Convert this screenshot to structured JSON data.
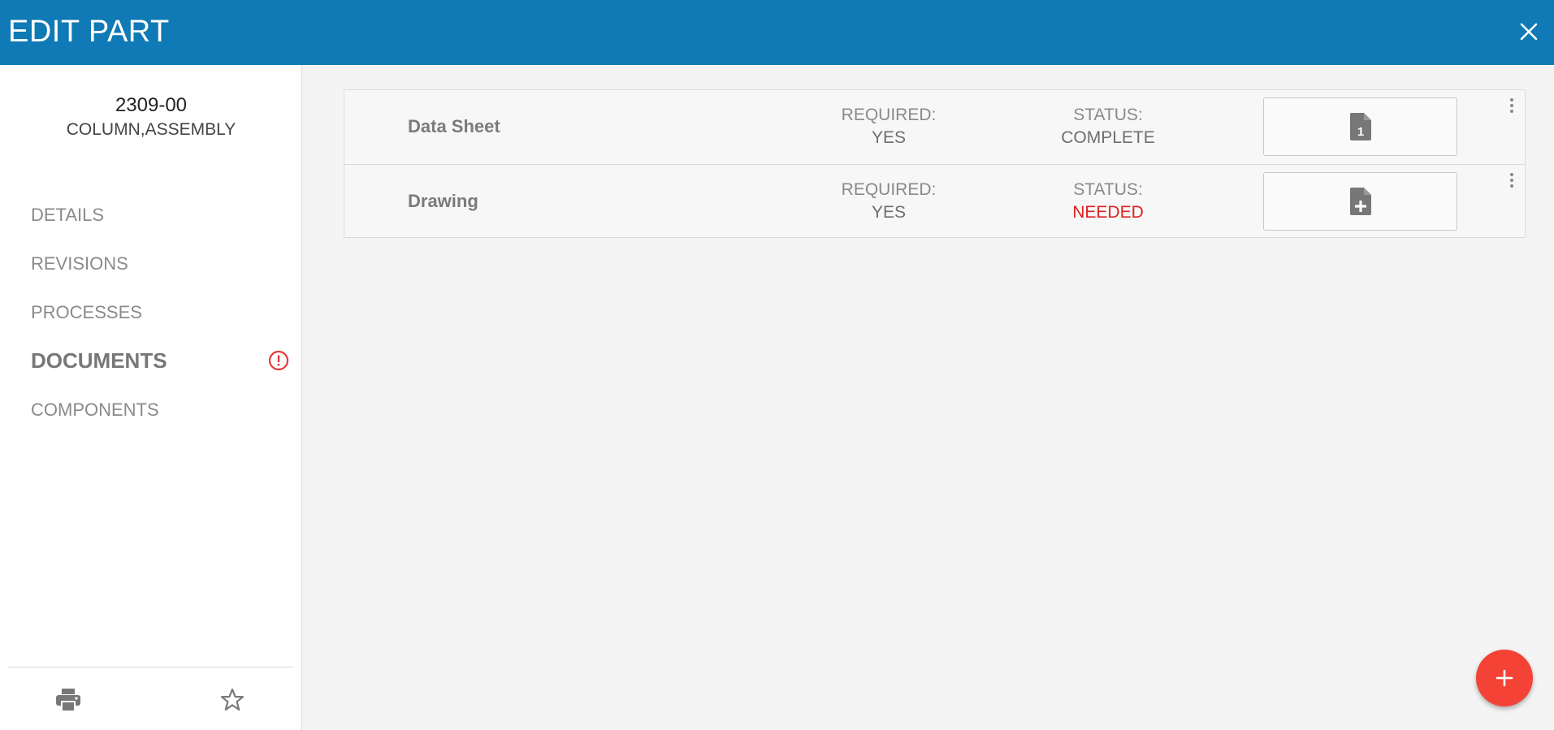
{
  "header": {
    "title": "EDIT PART",
    "close_icon": "close-icon"
  },
  "part": {
    "number": "2309-00",
    "description": "COLUMN,ASSEMBLY"
  },
  "nav": {
    "items": [
      {
        "label": "DETAILS",
        "active": false
      },
      {
        "label": "REVISIONS",
        "active": false
      },
      {
        "label": "PROCESSES",
        "active": false
      },
      {
        "label": "DOCUMENTS",
        "active": true,
        "alert_icon": "alert-circle-icon"
      },
      {
        "label": "COMPONENTS",
        "active": false
      }
    ]
  },
  "sidebar_footer": {
    "print_icon": "print-icon",
    "favorite_icon": "star-outline-icon"
  },
  "documents": [
    {
      "name": "Data Sheet",
      "required_label": "REQUIRED:",
      "required_value": "YES",
      "status_label": "STATUS:",
      "status_value": "COMPLETE",
      "file_icon": "file-count-icon",
      "file_count": "1",
      "menu_icon": "more-vertical-icon"
    },
    {
      "name": "Drawing",
      "required_label": "REQUIRED:",
      "required_value": "YES",
      "status_label": "STATUS:",
      "status_value": "NEEDED",
      "file_icon": "file-add-icon",
      "menu_icon": "more-vertical-icon"
    }
  ],
  "fab": {
    "icon": "plus-icon"
  },
  "colors": {
    "header": "#0f7ab5",
    "status_needed": "#e02020",
    "fab": "#f44336",
    "alert": "#e53935"
  }
}
